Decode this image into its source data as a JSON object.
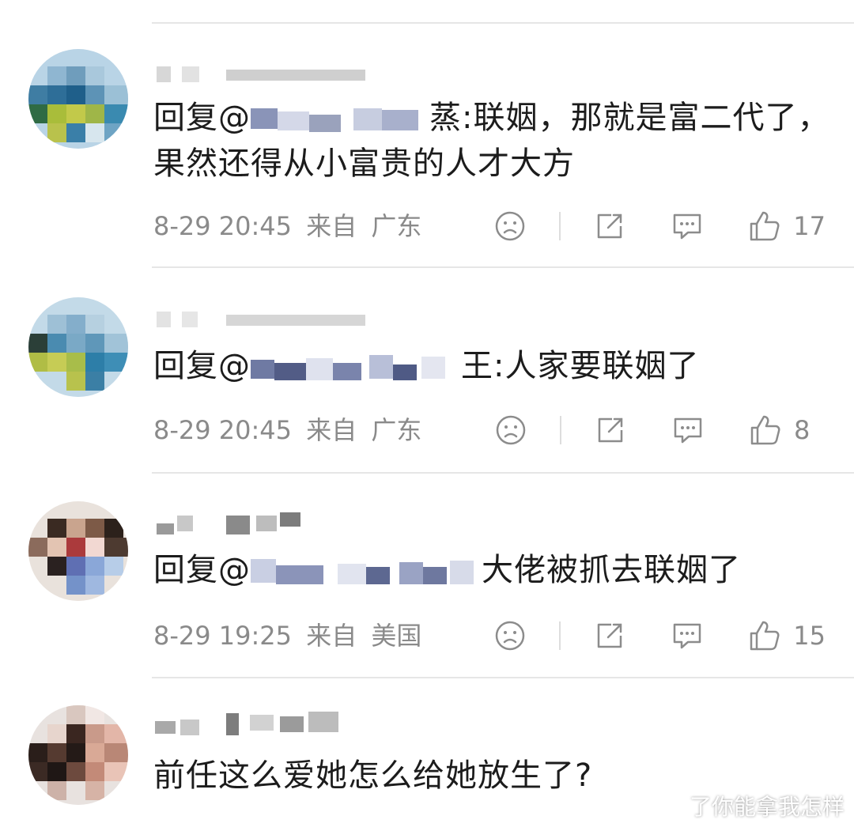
{
  "comments": [
    {
      "text_prefix": "回复@",
      "mention_tail": "蒸:",
      "text": "联姻，那就是富二代了，果然还得从小富贵的人才大方",
      "time": "8-29 20:45",
      "from_label": "来自",
      "location": "广东",
      "likes": "17"
    },
    {
      "text_prefix": "回复@",
      "mention_tail": "王:",
      "text": "人家要联姻了",
      "time": "8-29 20:45",
      "from_label": "来自",
      "location": "广东",
      "likes": "8"
    },
    {
      "text_prefix": "回复@",
      "mention_tail": "",
      "text": "大佬被抓去联姻了",
      "time": "8-29 19:25",
      "from_label": "来自",
      "location": "美国",
      "likes": "15"
    },
    {
      "text_prefix": "",
      "mention_tail": "",
      "text": "前任这么爱她怎么给她放生了?",
      "time": "",
      "from_label": "",
      "location": "",
      "likes": ""
    }
  ],
  "icons": {
    "dislike": "sad-face-icon",
    "share": "share-icon",
    "comment": "comment-bubble-icon",
    "like": "thumbs-up-icon"
  },
  "watermark": "了你能拿我怎样",
  "colors": {
    "text": "#1c1c1c",
    "meta": "#8a8a8a",
    "icon": "#8c8c8c",
    "divider": "#e6e6e6"
  }
}
